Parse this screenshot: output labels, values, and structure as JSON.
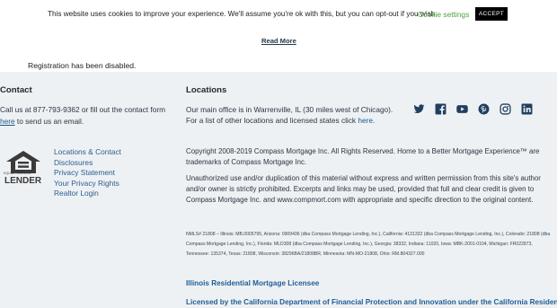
{
  "cookie": {
    "message": "This website uses cookies to improve your experience. We'll assume you're ok with this, but you can opt-out if you wish.",
    "settings_label": "Cookie settings",
    "accept_label": "ACCEPT",
    "read_more_label": "Read More"
  },
  "registration_notice": "Registration has been disabled.",
  "contact": {
    "heading": "Contact",
    "text_before": "Call us at 877-793-9362 or fill out the contact form ",
    "link_label": "here",
    "text_after": " to send us an email."
  },
  "badge": {
    "line1": "EQUAL HOUSING",
    "line2": "LENDER"
  },
  "footer_nav": [
    "Locations & Contact",
    "Disclosures",
    "Privacy Statement",
    "Your Privacy Rights",
    "Realtor Login"
  ],
  "locations": {
    "heading": "Locations",
    "line1": "Our main office is in Warrenville, IL (30 miles west of Chicago).",
    "line2_before": "For a list of other locations and licensed states click ",
    "line2_link": "here",
    "line2_after": "."
  },
  "social_icons": [
    "twitter-icon",
    "facebook-icon",
    "youtube-icon",
    "pinterest-icon",
    "instagram-icon",
    "linkedin-icon"
  ],
  "copyright": "Copyright 2008-2019 Compass Mortgage Inc. All Rights Reserved. Home to a Better Mortgage Experience™ are trademarks of Compass Mortgage Inc.",
  "unauthorized": "Unauthorized use and/or duplication of this material without express and written permission from this site's author and/or owner is strictly prohibited. Excerpts and links may be used, provided that full and clear credit is given to Compass Mortgage Inc. and www.compmort.com with appropriate and specific direction to the original content.",
  "nmls": "NMLS# 21808 – Illinois: MB.0005795, Arizona: 0909436 (dba Compass Mortgage Lending, Inc.), California: 4131332 (dba Compass Mortgage Lending, Inc.), Colorado: 21808 (dba Compass Mortgage Lending, Inc.), Florida: MLD308 (dba Compass Mortgage Lending, Inc.), Georgia: 38332, Indiana: 11020, Iowa: MBK-2001-0104, Michigan: FR022873, Tennessee: 135374, Texas: 21808, Wisconsin: 38296BA/21808BR, Minnesota: MN-MO-21808, Ohio: RM.804327.000",
  "illinois_link": "Illinois Residential Mortgage Licensee",
  "california_link": "Licensed by the California Department of Financial Protection and Innovation under the California Residential",
  "colors": {
    "accent_green": "#4aa33d",
    "link_blue": "#1f5e96",
    "social_blue": "#1f3f5f",
    "footer_bg": "#eef1f4"
  }
}
